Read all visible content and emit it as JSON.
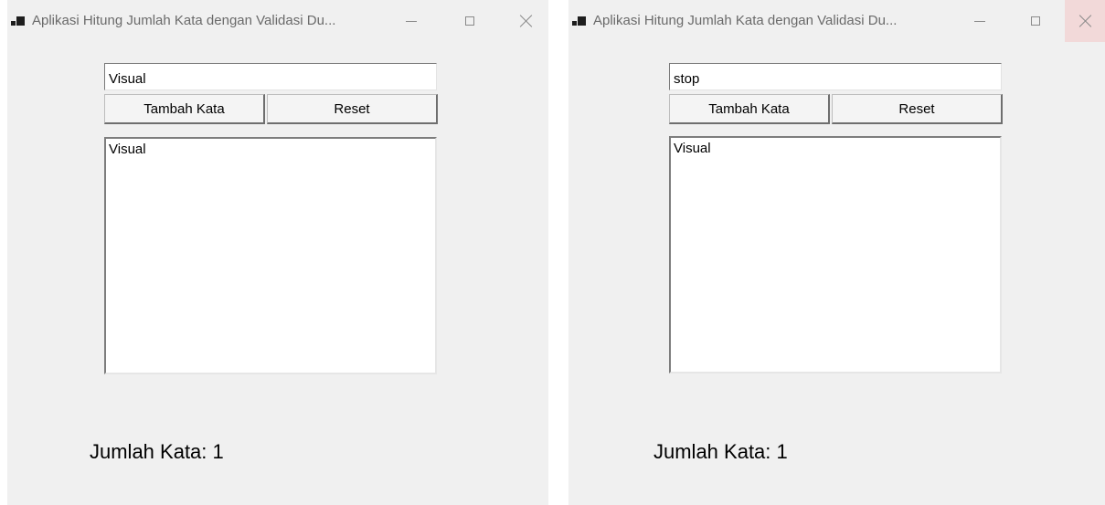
{
  "windows": [
    {
      "title": "Aplikasi Hitung Jumlah Kata dengan Validasi Du...",
      "icon": "app-window-icon",
      "input": {
        "value": "Visual"
      },
      "buttons": {
        "add_label": "Tambah Kata",
        "reset_label": "Reset"
      },
      "list_items": [
        "Visual"
      ],
      "count_label": "Jumlah Kata: 1"
    },
    {
      "title": "Aplikasi Hitung Jumlah Kata dengan Validasi Du...",
      "icon": "app-window-icon",
      "input": {
        "value": "stop"
      },
      "buttons": {
        "add_label": "Tambah Kata",
        "reset_label": "Reset"
      },
      "list_items": [
        "Visual"
      ],
      "count_label": "Jumlah Kata: 1",
      "close_hover_color": "#f2d9d9"
    }
  ]
}
